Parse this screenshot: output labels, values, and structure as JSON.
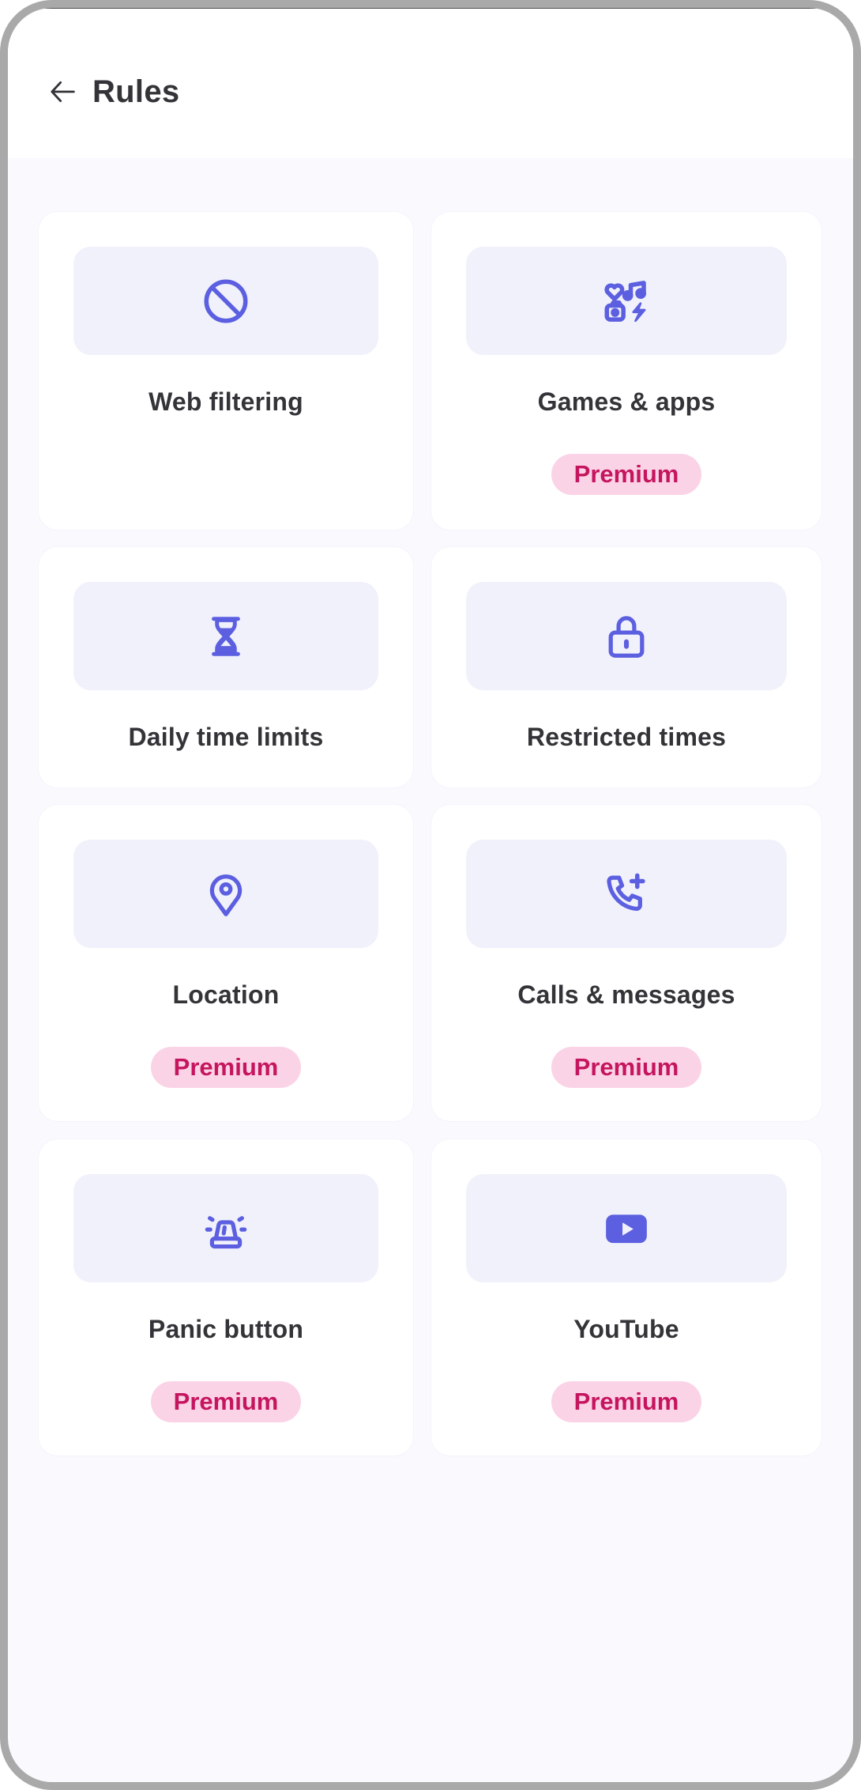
{
  "header": {
    "title": "Rules",
    "back_icon": "arrow-left-icon"
  },
  "colors": {
    "accent": "#5b5fe0",
    "icon_box_bg": "#f1f1fc",
    "premium_badge_bg": "#fbd3e6",
    "premium_badge_text": "#c5155e",
    "page_bg": "#f9f9fe",
    "text_primary": "#333338"
  },
  "rules": [
    {
      "label": "Web filtering",
      "icon": "block-icon",
      "premium": false,
      "badge": ""
    },
    {
      "label": "Games & apps",
      "icon": "apps-categories-icon",
      "premium": true,
      "badge": "Premium"
    },
    {
      "label": "Daily time limits",
      "icon": "hourglass-icon",
      "premium": false,
      "badge": ""
    },
    {
      "label": "Restricted times",
      "icon": "lock-icon",
      "premium": false,
      "badge": ""
    },
    {
      "label": "Location",
      "icon": "location-pin-icon",
      "premium": true,
      "badge": "Premium"
    },
    {
      "label": "Calls & messages",
      "icon": "phone-plus-icon",
      "premium": true,
      "badge": "Premium"
    },
    {
      "label": "Panic button",
      "icon": "siren-icon",
      "premium": true,
      "badge": "Premium"
    },
    {
      "label": "YouTube",
      "icon": "youtube-icon",
      "premium": true,
      "badge": "Premium"
    }
  ]
}
